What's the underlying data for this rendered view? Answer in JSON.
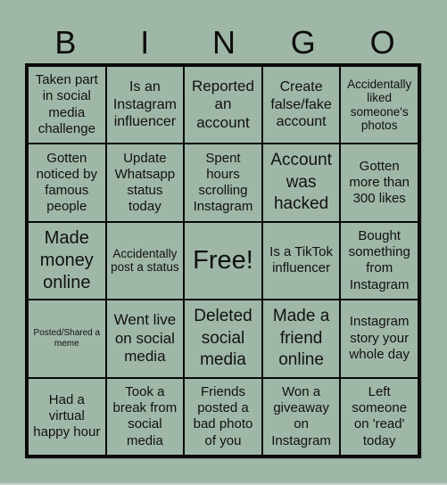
{
  "header": {
    "letters": [
      "B",
      "I",
      "N",
      "G",
      "O"
    ]
  },
  "colors": {
    "background": "#9fb7a7",
    "grid_lines": "#0a0a0a",
    "text": "#111111"
  },
  "board": {
    "rows": [
      [
        "Taken part in social media challenge",
        "Is an Instagram influencer",
        "Reported an account",
        "Create false/fake account",
        "Accidentally liked someone's photos"
      ],
      [
        "Gotten noticed by famous people",
        "Update Whatsapp status today",
        "Spent hours scrolling Instagram",
        "Account was hacked",
        "Gotten more than 300 likes"
      ],
      [
        "Made money online",
        "Accidentally post a status",
        "Free!",
        "Is a TikTok influencer",
        "Bought something from Instagram"
      ],
      [
        "Posted/Shared a meme",
        "Went live on social media",
        "Deleted social media",
        "Made a friend online",
        "Instagram story your whole day"
      ],
      [
        "Had a virtual happy hour",
        "Took a break from social media",
        "Friends posted a bad photo of you",
        "Won a giveaway on Instagram",
        "Left someone on 'read' today"
      ]
    ],
    "free_space": {
      "row": 2,
      "col": 2,
      "label": "Free!"
    }
  }
}
